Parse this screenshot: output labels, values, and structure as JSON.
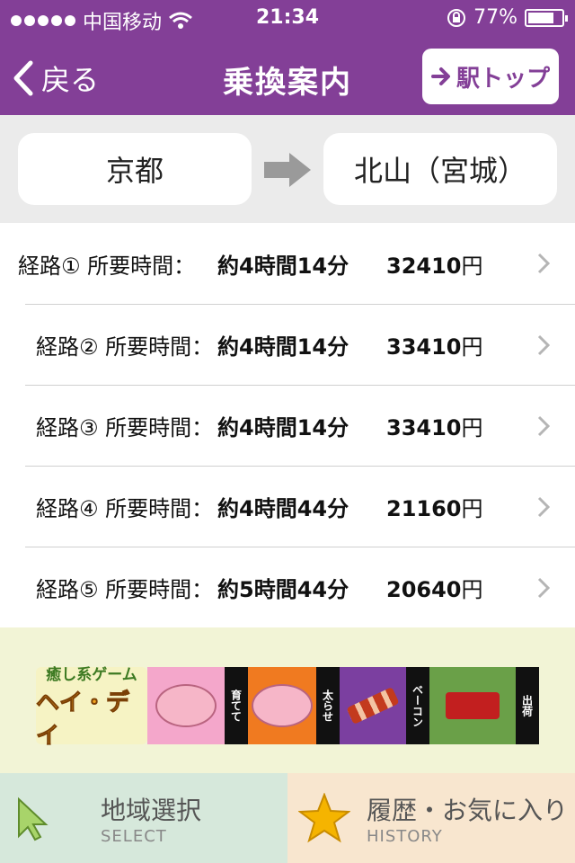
{
  "statusbar": {
    "carrier": "中国移动",
    "time": "21:34",
    "battery": "77%",
    "battery_level": 0.77
  },
  "nav": {
    "back": "戻る",
    "title": "乗換案内",
    "station_top": "駅トップ"
  },
  "stations": {
    "from": "京都",
    "to": "北山（宮城）"
  },
  "routes": [
    {
      "label": "経路① 所要時間：",
      "time": "約4時間14分",
      "price": "32410",
      "currency": "円"
    },
    {
      "label": "経路② 所要時間：",
      "time": "約4時間14分",
      "price": "33410",
      "currency": "円"
    },
    {
      "label": "経路③ 所要時間：",
      "time": "約4時間14分",
      "price": "33410",
      "currency": "円"
    },
    {
      "label": "経路④ 所要時間：",
      "time": "約4時間44分",
      "price": "21160",
      "currency": "円"
    },
    {
      "label": "経路⑤ 所要時間：",
      "time": "約5時間44分",
      "price": "20640",
      "currency": "円"
    }
  ],
  "ad": {
    "line1": "癒し系ゲーム",
    "line2": "ヘイ・デイ",
    "word1": "育てて",
    "word2": "太らせ",
    "word3": "ベーコン",
    "word4": "出荷"
  },
  "tabs": {
    "select": {
      "label": "地域選択",
      "sub": "SELECT"
    },
    "history": {
      "label": "履歴・お気に入り",
      "sub": "HISTORY"
    }
  },
  "colors": {
    "brand": "#833f97",
    "select_tab": "#d6e8db",
    "history_tab": "#f8e6cf"
  },
  "icons": [
    "signal-dots-icon",
    "wifi-icon",
    "rotation-lock-icon",
    "battery-icon",
    "back-chevron-icon",
    "right-arrow-icon",
    "chevron-right-icon",
    "cursor-arrow-icon",
    "star-icon"
  ]
}
